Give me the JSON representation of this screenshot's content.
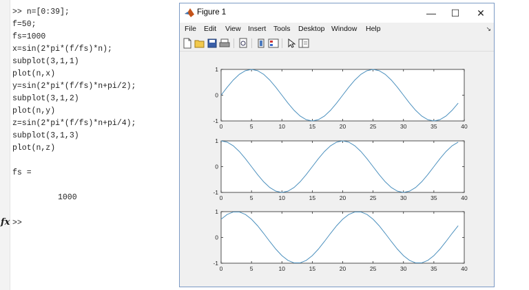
{
  "command_window": {
    "lines": [
      ">> n=[0:39];",
      "f=50;",
      "fs=1000",
      "x=sin(2*pi*(f/fs)*n);",
      "subplot(3,1,1)",
      "plot(n,x)",
      "y=sin(2*pi*(f/fs)*n+pi/2);",
      "subplot(3,1,2)",
      "plot(n,y)",
      "z=sin(2*pi*(f/fs)*n+pi/4);",
      "subplot(3,1,3)",
      "plot(n,z)"
    ],
    "output_var": "fs =",
    "output_value": "1000",
    "prompt": ">>",
    "fx_label": "fx"
  },
  "figure": {
    "title": "Figure 1",
    "window_buttons": {
      "minimize": "—",
      "maximize": "☐",
      "close": "✕"
    },
    "menu": [
      "File",
      "Edit",
      "View",
      "Insert",
      "Tools",
      "Desktop",
      "Window",
      "Help"
    ],
    "menu_expand": "↘",
    "toolbar_icons": [
      "new-figure-icon",
      "open-file-icon",
      "save-icon",
      "print-icon",
      "print-preview-icon",
      "link-icon",
      "insert-legend-icon",
      "edit-plot-icon",
      "property-inspector-icon"
    ]
  },
  "chart_data": [
    {
      "type": "line",
      "n_start": 0,
      "n_end": 39,
      "expression": "x=sin(2*pi*(f/fs)*n)",
      "f": 50,
      "fs": 1000,
      "phase": 0,
      "xlim": [
        0,
        40
      ],
      "ylim": [
        -1,
        1
      ],
      "xticks": [
        0,
        5,
        10,
        15,
        20,
        25,
        30,
        35,
        40
      ],
      "yticks": [
        -1,
        0,
        1
      ],
      "color": "#4a8fbd",
      "grid": false
    },
    {
      "type": "line",
      "n_start": 0,
      "n_end": 39,
      "expression": "y=sin(2*pi*(f/fs)*n+pi/2)",
      "f": 50,
      "fs": 1000,
      "phase": 1.5708,
      "xlim": [
        0,
        40
      ],
      "ylim": [
        -1,
        1
      ],
      "xticks": [
        0,
        5,
        10,
        15,
        20,
        25,
        30,
        35,
        40
      ],
      "yticks": [
        -1,
        0,
        1
      ],
      "color": "#4a8fbd",
      "grid": false
    },
    {
      "type": "line",
      "n_start": 0,
      "n_end": 39,
      "expression": "z=sin(2*pi*(f/fs)*n+pi/4)",
      "f": 50,
      "fs": 1000,
      "phase": 0.7854,
      "xlim": [
        0,
        40
      ],
      "ylim": [
        -1,
        1
      ],
      "xticks": [
        0,
        5,
        10,
        15,
        20,
        25,
        30,
        35,
        40
      ],
      "yticks": [
        -1,
        0,
        1
      ],
      "color": "#4a8fbd",
      "grid": false
    }
  ]
}
